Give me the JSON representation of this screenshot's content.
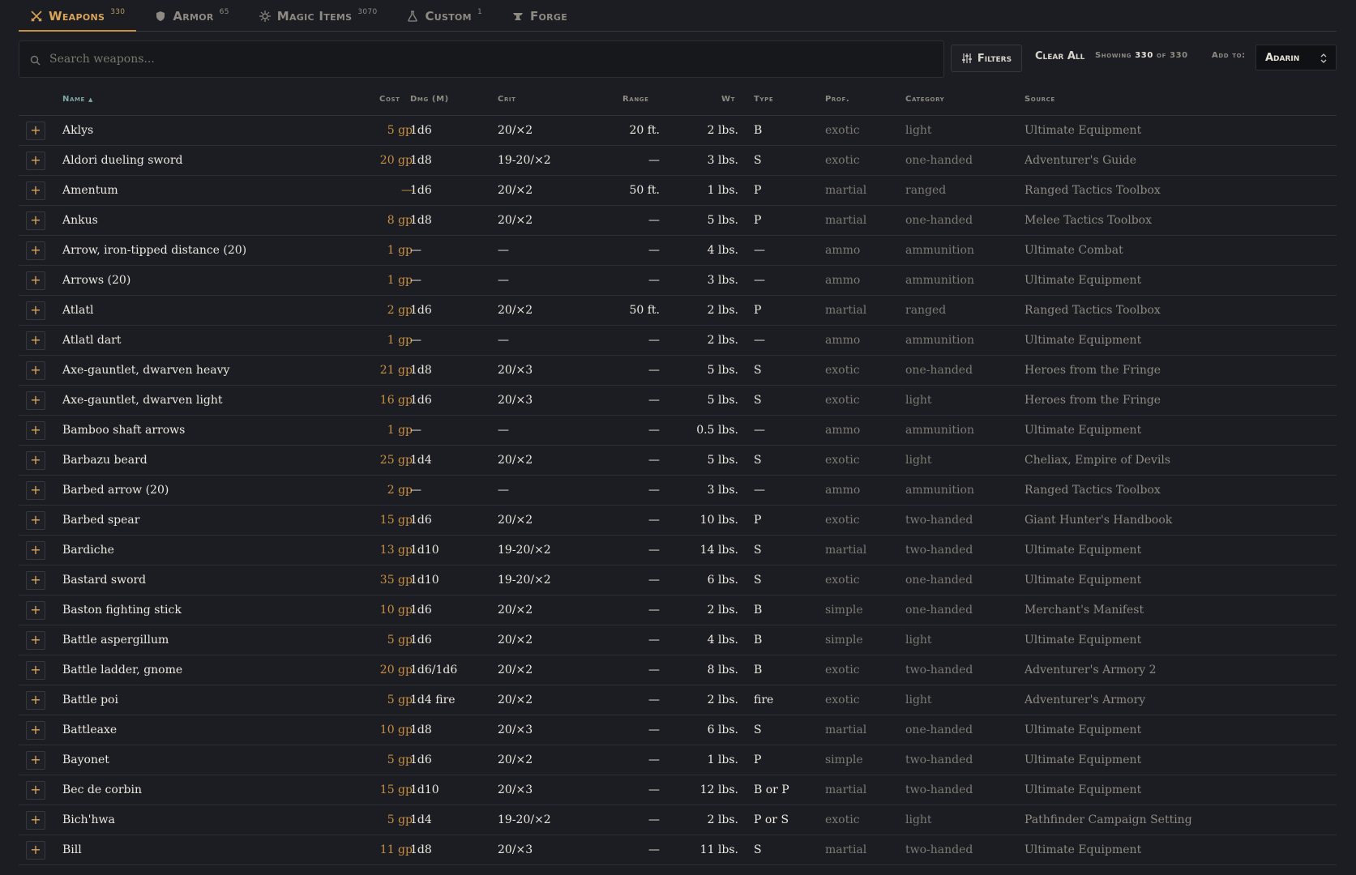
{
  "tabs": [
    {
      "label": "Weapons",
      "count": "330",
      "icon": "crossed-swords-icon",
      "active": true
    },
    {
      "label": "Armor",
      "count": "65",
      "icon": "shield-icon",
      "active": false
    },
    {
      "label": "Magic Items",
      "count": "3070",
      "icon": "sparkle-icon",
      "active": false
    },
    {
      "label": "Custom",
      "count": "1",
      "icon": "flask-icon",
      "active": false
    },
    {
      "label": "Forge",
      "count": "",
      "icon": "anvil-icon",
      "active": false
    }
  ],
  "toolbar": {
    "search_placeholder": "Search weapons...",
    "filters_label": "Filters",
    "clear_label": "Clear All",
    "showing_prefix": "Showing",
    "showing_count": "330",
    "showing_of": "of",
    "showing_total": "330",
    "add_to_label": "Add to:",
    "character_selected": "Adarin"
  },
  "table": {
    "headers": {
      "name": "Name",
      "cost": "Cost",
      "dmg": "Dmg (M)",
      "crit": "Crit",
      "range": "Range",
      "wt": "Wt",
      "type": "Type",
      "prof": "Prof.",
      "category": "Category",
      "source": "Source"
    },
    "sort_indicator": "▲",
    "rows": [
      {
        "name": "Aklys",
        "cost": "5 gp",
        "dmg": "1d6",
        "crit": "20/×2",
        "range": "20 ft.",
        "wt": "2 lbs.",
        "type": "B",
        "prof": "exotic",
        "category": "light",
        "source": "Ultimate Equipment"
      },
      {
        "name": "Aldori dueling sword",
        "cost": "20 gp",
        "dmg": "1d8",
        "crit": "19-20/×2",
        "range": "—",
        "wt": "3 lbs.",
        "type": "S",
        "prof": "exotic",
        "category": "one-handed",
        "source": "Adventurer's Guide"
      },
      {
        "name": "Amentum",
        "cost": "—",
        "dmg": "1d6",
        "crit": "20/×2",
        "range": "50 ft.",
        "wt": "1 lbs.",
        "type": "P",
        "prof": "martial",
        "category": "ranged",
        "source": "Ranged Tactics Toolbox"
      },
      {
        "name": "Ankus",
        "cost": "8 gp",
        "dmg": "1d8",
        "crit": "20/×2",
        "range": "—",
        "wt": "5 lbs.",
        "type": "P",
        "prof": "martial",
        "category": "one-handed",
        "source": "Melee Tactics Toolbox"
      },
      {
        "name": "Arrow, iron-tipped distance (20)",
        "cost": "1 gp",
        "dmg": "—",
        "crit": "—",
        "range": "—",
        "wt": "4 lbs.",
        "type": "—",
        "prof": "ammo",
        "category": "ammunition",
        "source": "Ultimate Combat"
      },
      {
        "name": "Arrows (20)",
        "cost": "1 gp",
        "dmg": "—",
        "crit": "—",
        "range": "—",
        "wt": "3 lbs.",
        "type": "—",
        "prof": "ammo",
        "category": "ammunition",
        "source": "Ultimate Equipment"
      },
      {
        "name": "Atlatl",
        "cost": "2 gp",
        "dmg": "1d6",
        "crit": "20/×2",
        "range": "50 ft.",
        "wt": "2 lbs.",
        "type": "P",
        "prof": "martial",
        "category": "ranged",
        "source": "Ranged Tactics Toolbox"
      },
      {
        "name": "Atlatl dart",
        "cost": "1 gp",
        "dmg": "—",
        "crit": "—",
        "range": "—",
        "wt": "2 lbs.",
        "type": "—",
        "prof": "ammo",
        "category": "ammunition",
        "source": "Ultimate Equipment"
      },
      {
        "name": "Axe-gauntlet, dwarven heavy",
        "cost": "21 gp",
        "dmg": "1d8",
        "crit": "20/×3",
        "range": "—",
        "wt": "5 lbs.",
        "type": "S",
        "prof": "exotic",
        "category": "one-handed",
        "source": "Heroes from the Fringe"
      },
      {
        "name": "Axe-gauntlet, dwarven light",
        "cost": "16 gp",
        "dmg": "1d6",
        "crit": "20/×3",
        "range": "—",
        "wt": "5 lbs.",
        "type": "S",
        "prof": "exotic",
        "category": "light",
        "source": "Heroes from the Fringe"
      },
      {
        "name": "Bamboo shaft arrows",
        "cost": "1 gp",
        "dmg": "—",
        "crit": "—",
        "range": "—",
        "wt": "0.5 lbs.",
        "type": "—",
        "prof": "ammo",
        "category": "ammunition",
        "source": "Ultimate Equipment"
      },
      {
        "name": "Barbazu beard",
        "cost": "25 gp",
        "dmg": "1d4",
        "crit": "20/×2",
        "range": "—",
        "wt": "5 lbs.",
        "type": "S",
        "prof": "exotic",
        "category": "light",
        "source": "Cheliax, Empire of Devils"
      },
      {
        "name": "Barbed arrow (20)",
        "cost": "2 gp",
        "dmg": "—",
        "crit": "—",
        "range": "—",
        "wt": "3 lbs.",
        "type": "—",
        "prof": "ammo",
        "category": "ammunition",
        "source": "Ranged Tactics Toolbox"
      },
      {
        "name": "Barbed spear",
        "cost": "15 gp",
        "dmg": "1d6",
        "crit": "20/×2",
        "range": "—",
        "wt": "10 lbs.",
        "type": "P",
        "prof": "exotic",
        "category": "two-handed",
        "source": "Giant Hunter's Handbook"
      },
      {
        "name": "Bardiche",
        "cost": "13 gp",
        "dmg": "1d10",
        "crit": "19-20/×2",
        "range": "—",
        "wt": "14 lbs.",
        "type": "S",
        "prof": "martial",
        "category": "two-handed",
        "source": "Ultimate Equipment"
      },
      {
        "name": "Bastard sword",
        "cost": "35 gp",
        "dmg": "1d10",
        "crit": "19-20/×2",
        "range": "—",
        "wt": "6 lbs.",
        "type": "S",
        "prof": "exotic",
        "category": "one-handed",
        "source": "Ultimate Equipment"
      },
      {
        "name": "Baston fighting stick",
        "cost": "10 gp",
        "dmg": "1d6",
        "crit": "20/×2",
        "range": "—",
        "wt": "2 lbs.",
        "type": "B",
        "prof": "simple",
        "category": "one-handed",
        "source": "Merchant's Manifest"
      },
      {
        "name": "Battle aspergillum",
        "cost": "5 gp",
        "dmg": "1d6",
        "crit": "20/×2",
        "range": "—",
        "wt": "4 lbs.",
        "type": "B",
        "prof": "simple",
        "category": "light",
        "source": "Ultimate Equipment"
      },
      {
        "name": "Battle ladder, gnome",
        "cost": "20 gp",
        "dmg": "1d6/1d6",
        "crit": "20/×2",
        "range": "—",
        "wt": "8 lbs.",
        "type": "B",
        "prof": "exotic",
        "category": "two-handed",
        "source": "Adventurer's Armory 2"
      },
      {
        "name": "Battle poi",
        "cost": "5 gp",
        "dmg": "1d4 fire",
        "crit": "20/×2",
        "range": "—",
        "wt": "2 lbs.",
        "type": "fire",
        "prof": "exotic",
        "category": "light",
        "source": "Adventurer's Armory"
      },
      {
        "name": "Battleaxe",
        "cost": "10 gp",
        "dmg": "1d8",
        "crit": "20/×3",
        "range": "—",
        "wt": "6 lbs.",
        "type": "S",
        "prof": "martial",
        "category": "one-handed",
        "source": "Ultimate Equipment"
      },
      {
        "name": "Bayonet",
        "cost": "5 gp",
        "dmg": "1d6",
        "crit": "20/×2",
        "range": "—",
        "wt": "1 lbs.",
        "type": "P",
        "prof": "simple",
        "category": "two-handed",
        "source": "Ultimate Equipment"
      },
      {
        "name": "Bec de corbin",
        "cost": "15 gp",
        "dmg": "1d10",
        "crit": "20/×3",
        "range": "—",
        "wt": "12 lbs.",
        "type": "B or P",
        "prof": "martial",
        "category": "two-handed",
        "source": "Ultimate Equipment"
      },
      {
        "name": "Bich'hwa",
        "cost": "5 gp",
        "dmg": "1d4",
        "crit": "19-20/×2",
        "range": "—",
        "wt": "2 lbs.",
        "type": "P or S",
        "prof": "exotic",
        "category": "light",
        "source": "Pathfinder Campaign Setting"
      },
      {
        "name": "Bill",
        "cost": "11 gp",
        "dmg": "1d8",
        "crit": "20/×3",
        "range": "—",
        "wt": "11 lbs.",
        "type": "S",
        "prof": "martial",
        "category": "two-handed",
        "source": "Ultimate Equipment"
      }
    ]
  },
  "colors": {
    "background": "#1b1d22",
    "accent": "#c98f43",
    "header_sorted": "#7fa6a4",
    "muted_text": "#7d7a73"
  }
}
